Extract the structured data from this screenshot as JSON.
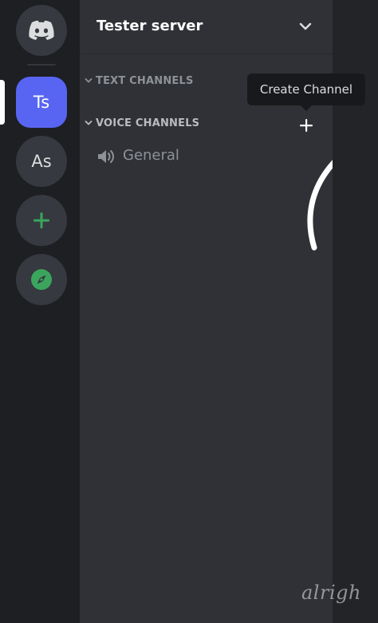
{
  "servers": [
    {
      "name": "home",
      "label": ""
    },
    {
      "name": "tester-server",
      "label": "Ts"
    },
    {
      "name": "as-server",
      "label": "As"
    },
    {
      "name": "add-server",
      "label": ""
    },
    {
      "name": "explore",
      "label": ""
    }
  ],
  "header": {
    "server_name": "Tester server"
  },
  "categories": [
    {
      "label": "TEXT CHANNELS"
    },
    {
      "label": "VOICE CHANNELS"
    }
  ],
  "channels": [
    {
      "name": "General",
      "type": "voice"
    }
  ],
  "tooltip": {
    "text": "Create Channel"
  },
  "watermark": "alrigh",
  "colors": {
    "accent": "#5865f2",
    "add_green": "#3ba55d",
    "panel_bg": "#2f3136",
    "rail_bg": "#1d1f23"
  },
  "icons": {
    "home": "discord-logo-icon",
    "add": "plus-icon",
    "explore": "compass-icon",
    "speaker": "speaker-icon",
    "chevron": "chevron-down-icon",
    "create": "plus-icon"
  }
}
